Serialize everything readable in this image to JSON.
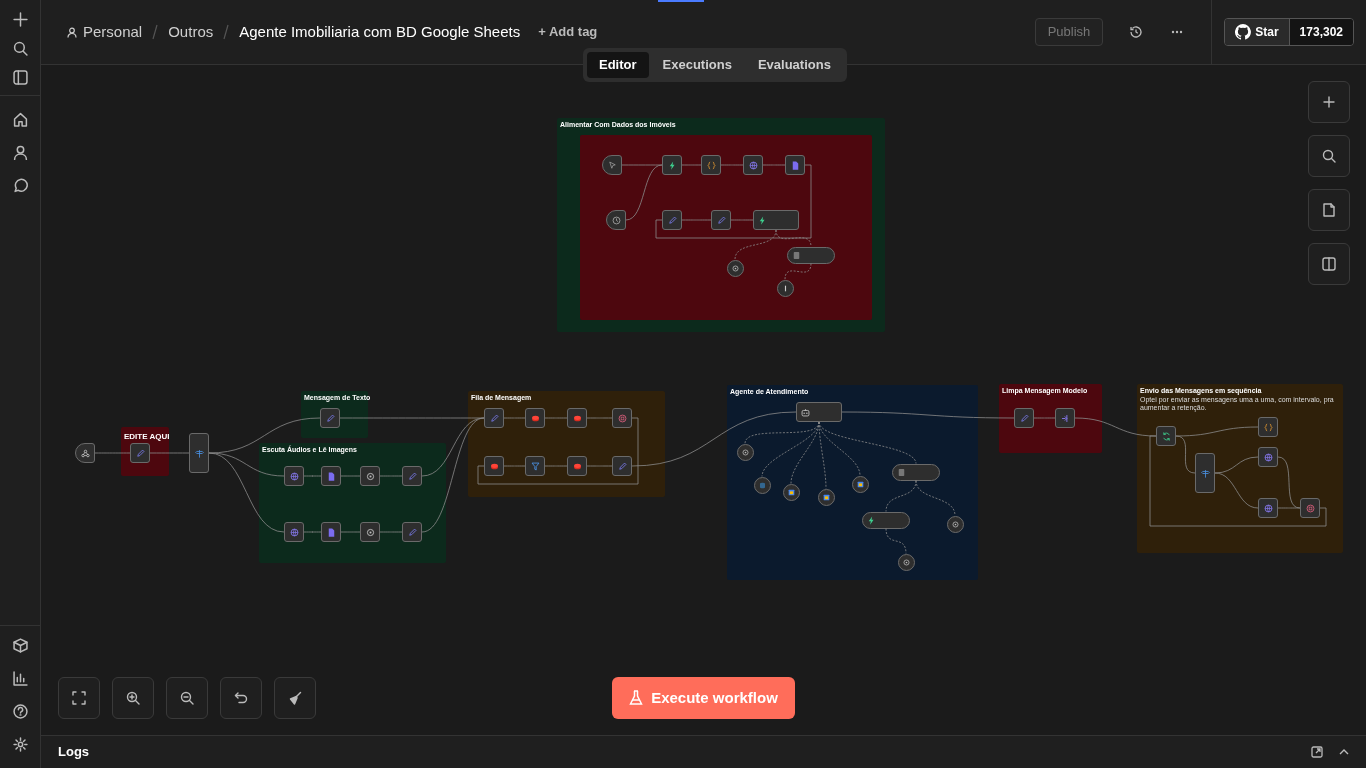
{
  "breadcrumb": {
    "owner": "Personal",
    "folder": "Outros",
    "title": "Agente Imobiliaria com BD Google Sheets",
    "add_tag": "+ Add tag"
  },
  "header": {
    "publish": {
      "label": "Publish",
      "disabled": true
    },
    "github": {
      "label": "Star",
      "count": "173,302"
    }
  },
  "tabs": [
    {
      "label": "Editor",
      "selected": true
    },
    {
      "label": "Executions",
      "selected": false
    },
    {
      "label": "Evaluations",
      "selected": false
    }
  ],
  "sticky_notes": [
    {
      "title": "Alimentar Com Dados dos Imóveis",
      "color": "#0c2a1c"
    },
    {
      "color": "#4d070e"
    },
    {
      "title": "EDITE AQUI",
      "color": "#4d070e"
    },
    {
      "title": "Mensagem de Texto",
      "color": "#0c2a1c"
    },
    {
      "title": "Escuta Áudios e Lê Imagens",
      "color": "#0c2a1c"
    },
    {
      "title": "Fila de Mensagem",
      "color": "#2f200a"
    },
    {
      "title": "Agente de Atendimento",
      "color": "#0b1a2d"
    },
    {
      "title": "Limpa Mensagem Modelo",
      "color": "#4d070e"
    },
    {
      "title": "Envio das Mensagens em sequência",
      "description": "Optei por enviar as mensagens uma a uma, com intervalo, pra aumentar a retenção.",
      "color": "#2f200a"
    }
  ],
  "nodes": [
    {
      "kind": "trigger"
    },
    {
      "kind": "node"
    },
    {
      "kind": "node"
    },
    {
      "kind": "node"
    },
    {
      "kind": "node"
    },
    {
      "kind": "trigger"
    },
    {
      "kind": "node"
    },
    {
      "kind": "node"
    },
    {
      "kind": "wide"
    },
    {
      "kind": "pill"
    },
    {
      "kind": "sub"
    },
    {
      "kind": "sub"
    },
    {
      "kind": "trigger"
    },
    {
      "kind": "node"
    },
    {
      "kind": "tall"
    },
    {
      "kind": "node"
    },
    {
      "kind": "node"
    },
    {
      "kind": "node"
    },
    {
      "kind": "node"
    },
    {
      "kind": "node"
    },
    {
      "kind": "node"
    },
    {
      "kind": "node"
    },
    {
      "kind": "node"
    },
    {
      "kind": "node"
    },
    {
      "kind": "node"
    },
    {
      "kind": "node"
    },
    {
      "kind": "node"
    },
    {
      "kind": "node"
    },
    {
      "kind": "node"
    },
    {
      "kind": "node"
    },
    {
      "kind": "node"
    },
    {
      "kind": "node"
    },
    {
      "kind": "wide"
    },
    {
      "kind": "sub"
    },
    {
      "kind": "sub"
    },
    {
      "kind": "sub"
    },
    {
      "kind": "sub"
    },
    {
      "kind": "sub"
    },
    {
      "kind": "pill"
    },
    {
      "kind": "pill"
    },
    {
      "kind": "sub"
    },
    {
      "kind": "sub"
    },
    {
      "kind": "node"
    },
    {
      "kind": "node"
    },
    {
      "kind": "node"
    },
    {
      "kind": "node"
    },
    {
      "kind": "tall"
    },
    {
      "kind": "node"
    },
    {
      "kind": "node"
    },
    {
      "kind": "node"
    }
  ],
  "execute_button": "Execute workflow",
  "logs": "Logs"
}
